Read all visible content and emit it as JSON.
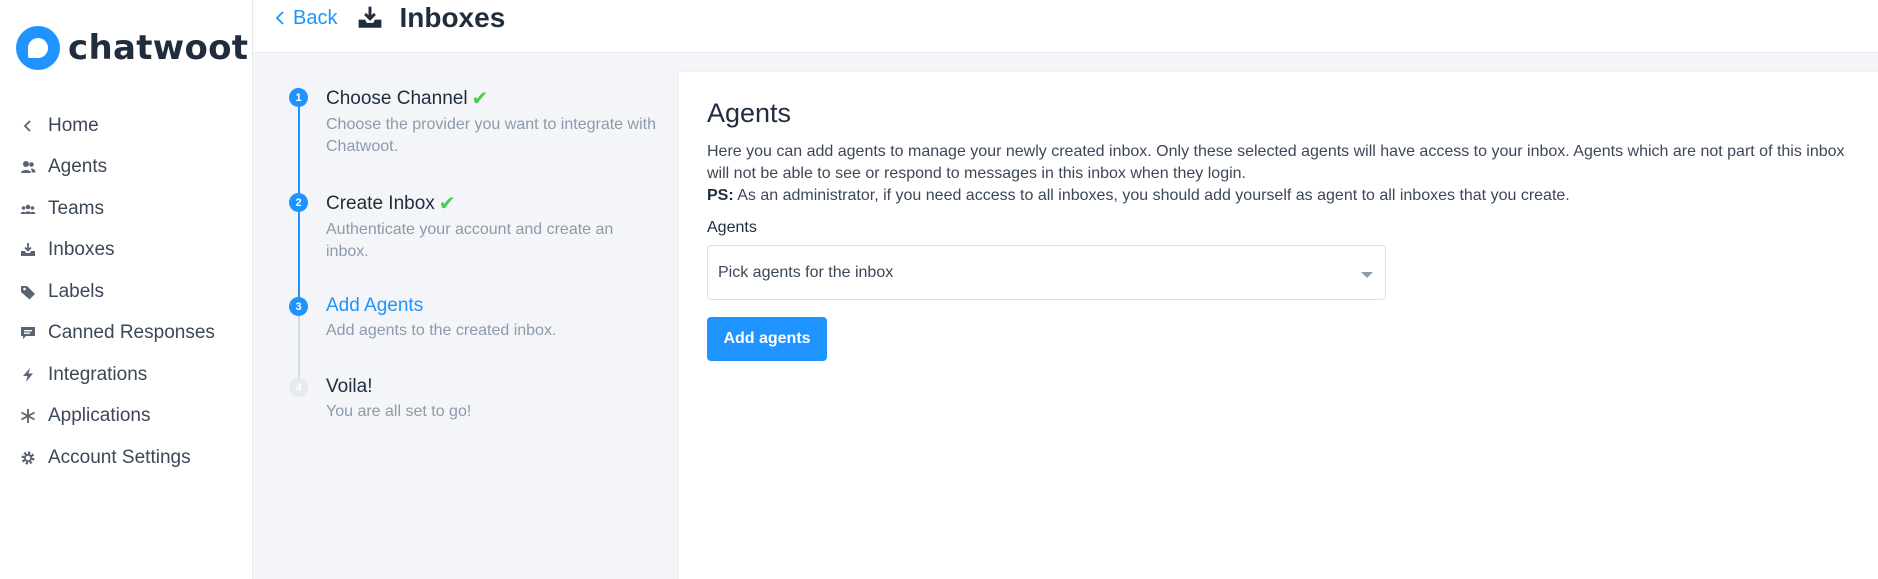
{
  "brand": {
    "name": "chatwoot",
    "color": "#1f93ff"
  },
  "sidebar": {
    "items": [
      {
        "label": "Home",
        "icon": "chevron-left-icon"
      },
      {
        "label": "Agents",
        "icon": "people-icon"
      },
      {
        "label": "Teams",
        "icon": "team-icon"
      },
      {
        "label": "Inboxes",
        "icon": "inbox-icon"
      },
      {
        "label": "Labels",
        "icon": "tag-icon"
      },
      {
        "label": "Canned Responses",
        "icon": "chat-icon"
      },
      {
        "label": "Integrations",
        "icon": "lightning-icon"
      },
      {
        "label": "Applications",
        "icon": "asterisk-icon"
      },
      {
        "label": "Account Settings",
        "icon": "gear-icon"
      }
    ]
  },
  "header": {
    "back_label": "Back",
    "title": "Inboxes"
  },
  "steps": [
    {
      "number": "1",
      "title": "Choose Channel",
      "description": "Choose the provider you want to integrate with Chatwoot.",
      "done": true
    },
    {
      "number": "2",
      "title": "Create Inbox",
      "description": "Authenticate your account and create an inbox.",
      "done": true
    },
    {
      "number": "3",
      "title": "Add Agents",
      "description": "Add agents to the created inbox.",
      "active": true
    },
    {
      "number": "4",
      "title": "Voila!",
      "description": "You are all set to go!"
    }
  ],
  "agents_form": {
    "title": "Agents",
    "description": "Here you can add agents to manage your newly created inbox. Only these selected agents will have access to your inbox. Agents which are not part of this inbox will not be able to see or respond to messages in this inbox when they login.",
    "ps_label": "PS:",
    "ps_text": " As an administrator, if you need access to all inboxes, you should add yourself as agent to all inboxes that you create.",
    "field_label": "Agents",
    "select_placeholder": "Pick agents for the inbox",
    "submit_label": "Add agents"
  }
}
